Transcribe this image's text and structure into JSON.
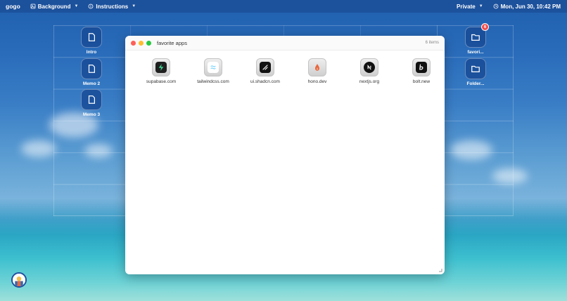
{
  "topbar": {
    "brand": "gogo",
    "background_label": "Background",
    "instructions_label": "Instructions",
    "mode_label": "Private",
    "datetime": "Mon, Jun 30, 10:42 PM"
  },
  "desktop": {
    "left_icons": [
      {
        "label": "Intro",
        "icon": "document-icon"
      },
      {
        "label": "Memo 2",
        "icon": "document-icon"
      },
      {
        "label": "Memo 3",
        "icon": "document-icon"
      }
    ],
    "right_icons": [
      {
        "label": "favori...",
        "icon": "folder-icon",
        "badge": "6"
      },
      {
        "label": "Folder...",
        "icon": "folder-icon"
      }
    ]
  },
  "window": {
    "title": "favorite apps",
    "item_count": "6 items",
    "apps": [
      {
        "label": "supabase.com",
        "icon": "supabase-icon",
        "color": "#1f1f1f"
      },
      {
        "label": "tailwindcss.com",
        "icon": "tailwind-icon",
        "color": "#ffffff"
      },
      {
        "label": "ui.shadcn.com",
        "icon": "shadcn-icon",
        "color": "#111111"
      },
      {
        "label": "hono.dev",
        "icon": "hono-icon",
        "color": "#e8663d"
      },
      {
        "label": "nextjs.org",
        "icon": "nextjs-icon",
        "color": "#111111"
      },
      {
        "label": "bolt.new",
        "icon": "bolt-icon",
        "color": "#111111"
      }
    ]
  },
  "colors": {
    "close": "#ff5f57",
    "minimize": "#febc2e",
    "maximize": "#28c840",
    "badge": "#ef4b4b"
  }
}
